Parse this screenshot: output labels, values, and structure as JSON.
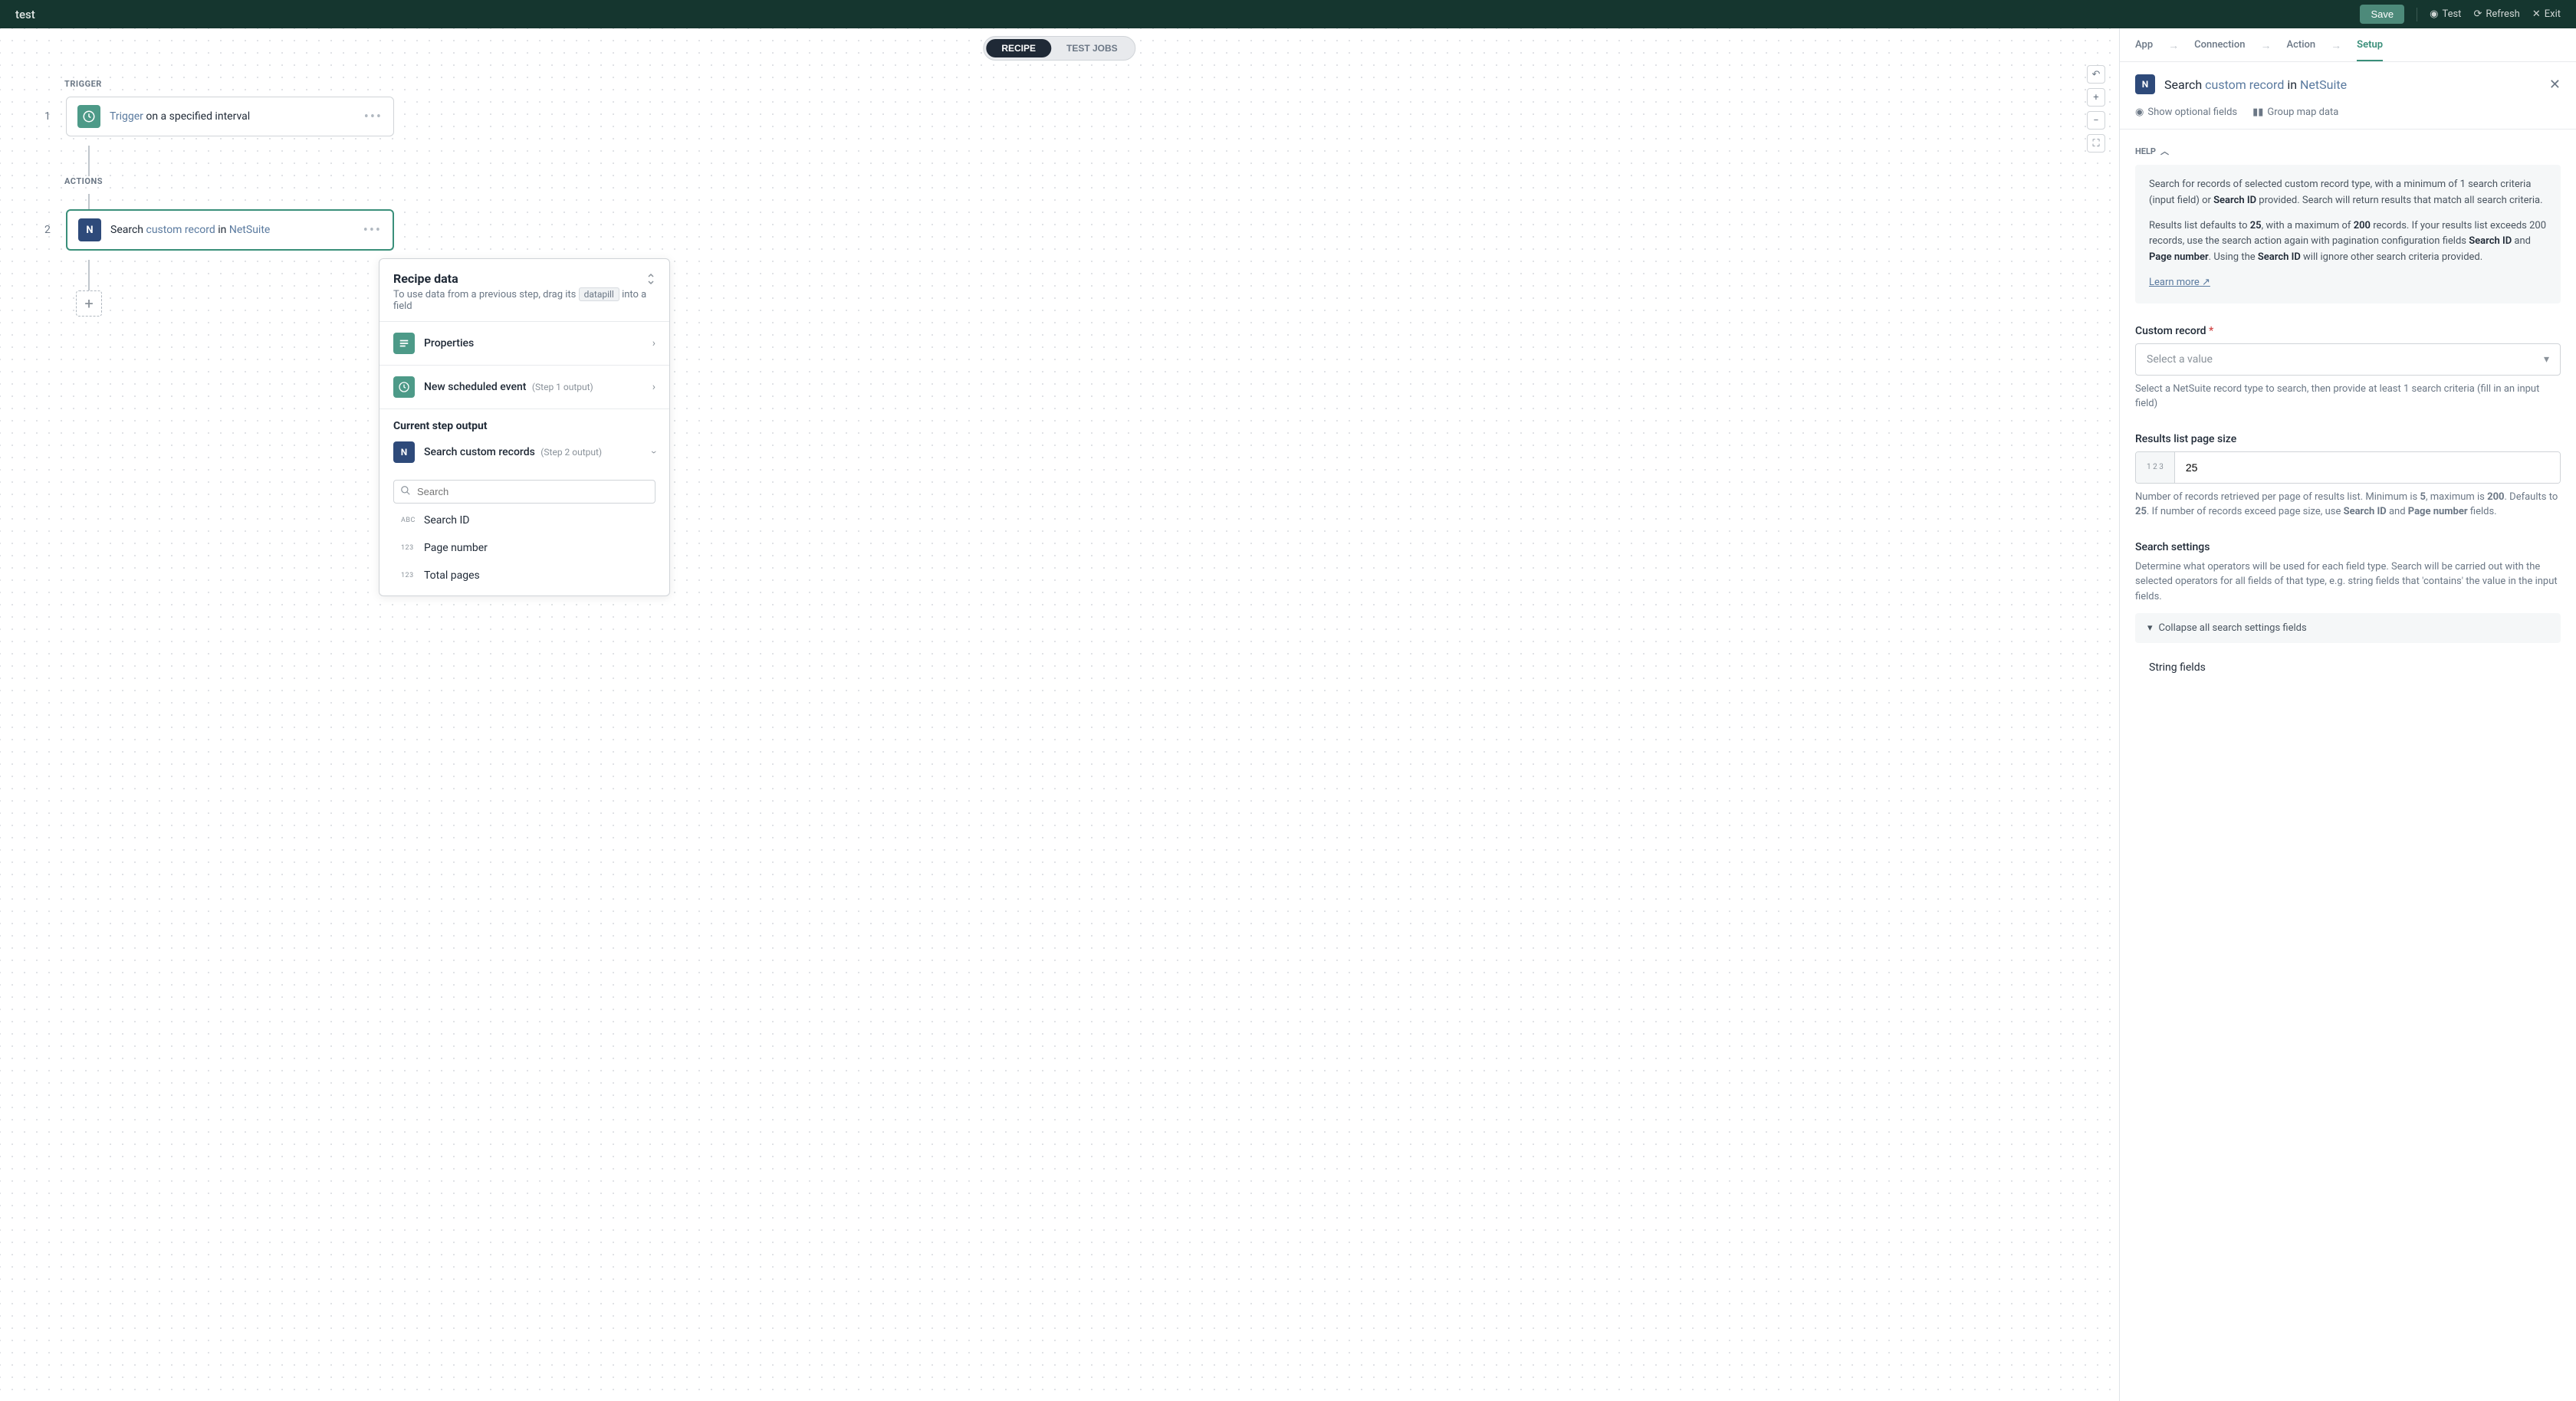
{
  "header": {
    "title": "test",
    "save": "Save",
    "test": "Test",
    "refresh": "Refresh",
    "exit": "Exit"
  },
  "tabs": {
    "recipe": "RECIPE",
    "testJobs": "TEST JOBS"
  },
  "flow": {
    "triggerLabel": "TRIGGER",
    "actionsLabel": "ACTIONS",
    "step1": {
      "num": "1",
      "prefix": "Trigger",
      "suffix": " on a specified interval"
    },
    "step2": {
      "num": "2",
      "prefix": "Search ",
      "link": "custom record",
      "in": " in ",
      "brand": "NetSuite"
    }
  },
  "dataPanel": {
    "title": "Recipe data",
    "sub1": "To use data from a previous step, drag its ",
    "pill": "datapill",
    "sub2": " into a field",
    "properties": "Properties",
    "schedEvent": "New scheduled event",
    "schedMeta": "(Step 1 output)",
    "currentHeading": "Current step output",
    "currentItem": "Search custom records",
    "currentMeta": "(Step 2 output)",
    "searchPlaceholder": "Search",
    "fields": [
      {
        "type": "ABC",
        "label": "Search ID"
      },
      {
        "type": "123",
        "label": "Page number"
      },
      {
        "type": "123",
        "label": "Total pages"
      }
    ]
  },
  "sidebar": {
    "tabs": {
      "app": "App",
      "connection": "Connection",
      "action": "Action",
      "setup": "Setup"
    },
    "title": {
      "prefix": "Search ",
      "link": "custom record",
      "in": " in ",
      "brand": "NetSuite"
    },
    "showOptional": "Show optional fields",
    "groupMap": "Group map data",
    "helpLabel": "HELP",
    "help": {
      "p1a": "Search for records of selected custom record type, with a minimum of 1 search criteria (input field) or ",
      "p1b": "Search ID",
      "p1c": " provided. Search will return results that match all search criteria.",
      "p2a": "Results list defaults to ",
      "p2b": "25",
      "p2c": ", with a maximum of ",
      "p2d": "200",
      "p2e": " records. If your results list exceeds 200 records, use the search action again with pagination configuration fields ",
      "p2f": "Search ID",
      "p2g": " and ",
      "p2h": "Page number",
      "p2i": ". Using the ",
      "p2j": "Search ID",
      "p2k": " will ignore other search criteria provided.",
      "learnMore": "Learn more"
    },
    "customRecord": {
      "label": "Custom record",
      "placeholder": "Select a value",
      "hint": "Select a NetSuite record type to search, then provide at least 1 search criteria (fill in an input field)"
    },
    "pageSize": {
      "label": "Results list page size",
      "value": "25",
      "hint1": "Number of records retrieved per page of results list. Minimum is ",
      "hint2": "5",
      "hint3": ", maximum is ",
      "hint4": "200",
      "hint5": ". Defaults to ",
      "hint6": "25",
      "hint7": ". If number of records exceed page size, use ",
      "hint8": "Search ID",
      "hint9": " and ",
      "hint10": "Page number",
      "hint11": " fields."
    },
    "searchSettings": {
      "label": "Search settings",
      "hint": "Determine what operators will be used for each field type. Search will be carried out with the selected operators for all fields of that type, e.g. string fields that 'contains' the value in the input fields.",
      "collapse": "Collapse all search settings fields",
      "stringFields": "String fields"
    }
  }
}
